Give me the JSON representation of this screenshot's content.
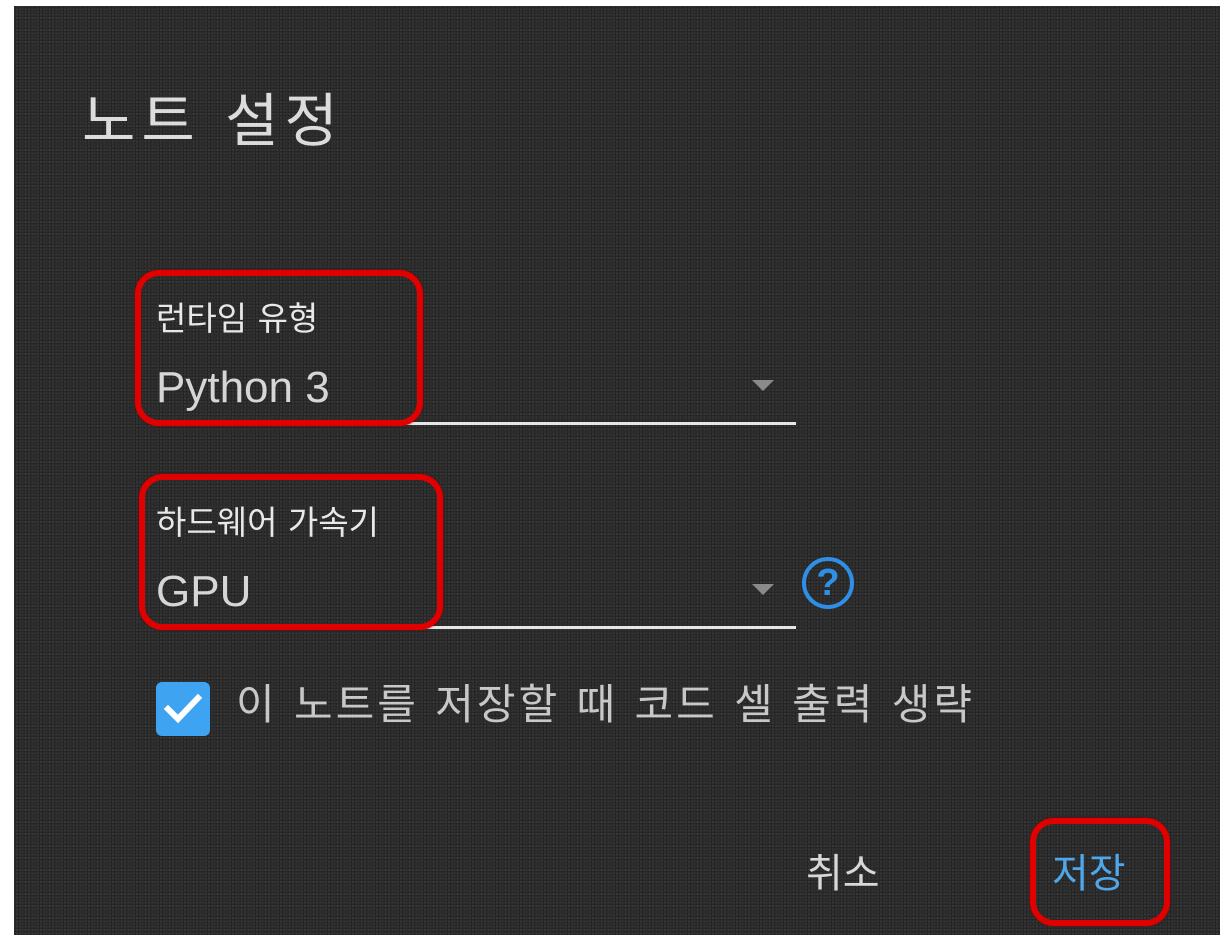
{
  "dialog": {
    "title": "노트 설정",
    "runtime": {
      "label": "런타임 유형",
      "value": "Python 3"
    },
    "accelerator": {
      "label": "하드웨어 가속기",
      "value": "GPU",
      "help_icon": "help-circle-icon",
      "help_glyph": "?"
    },
    "omit_output": {
      "checked": true,
      "label": "이 노트를 저장할 때 코드 셀 출력 생략"
    },
    "buttons": {
      "cancel": "취소",
      "save": "저장"
    }
  },
  "colors": {
    "background": "#2f2f2f",
    "accent": "#3ea3f0",
    "highlight": "#e00000"
  }
}
